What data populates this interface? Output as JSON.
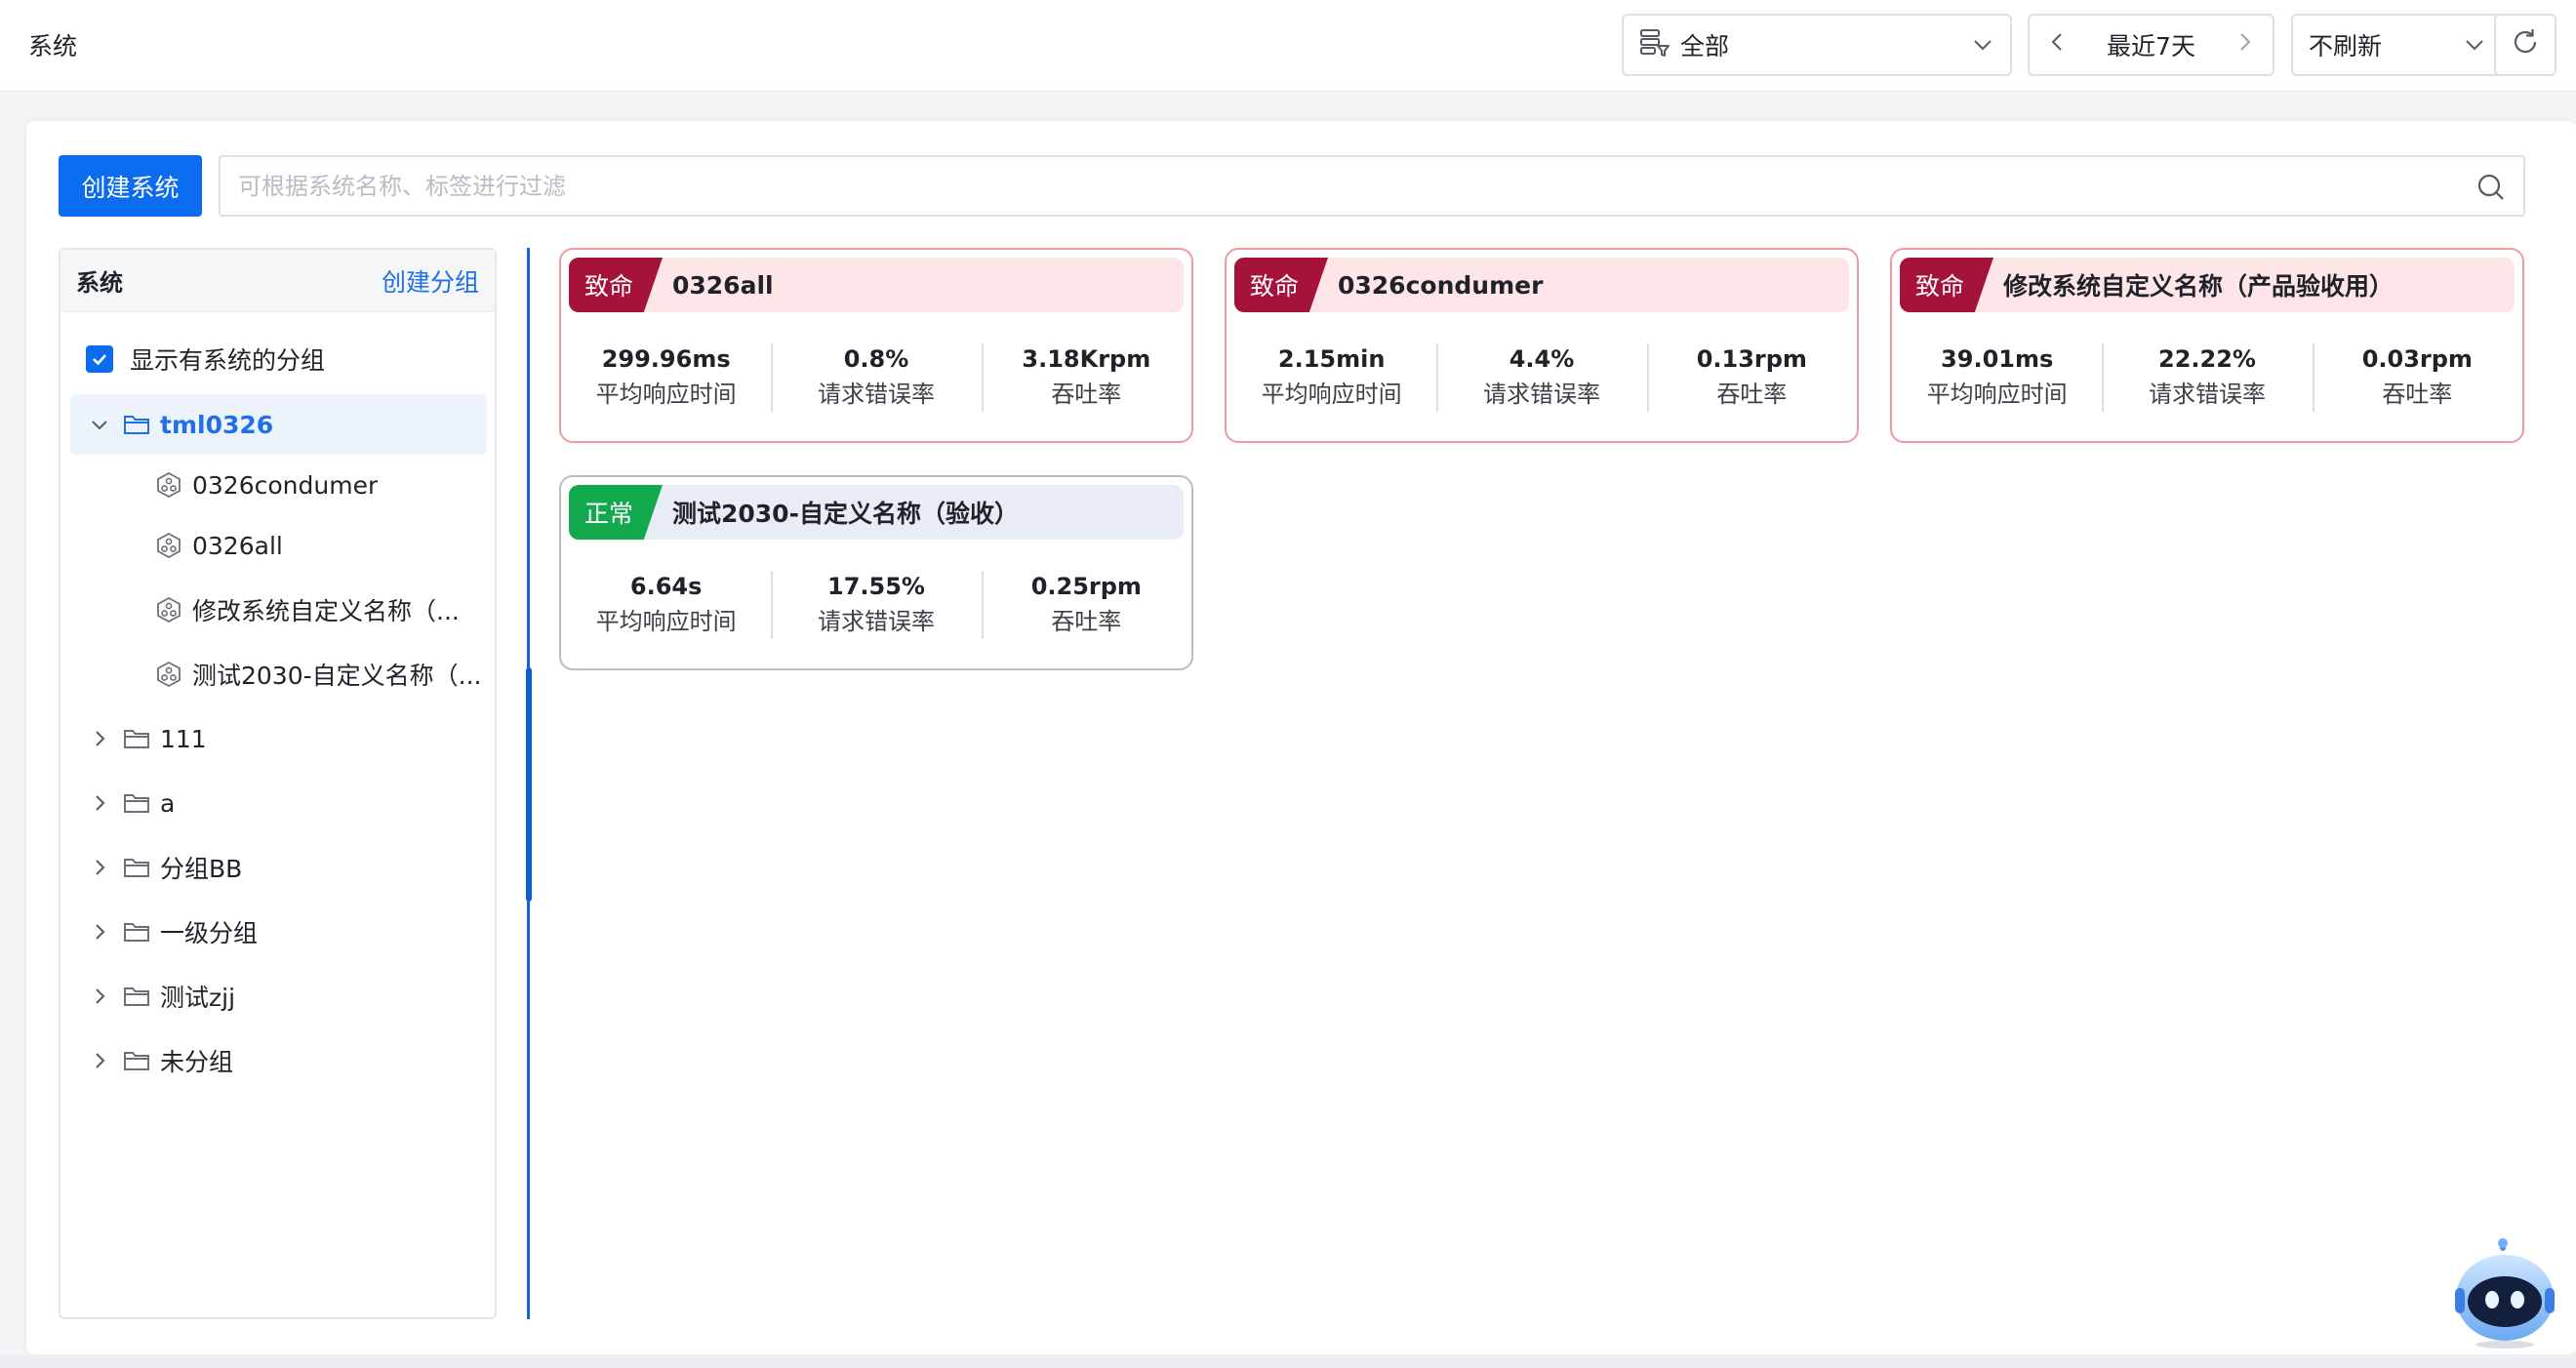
{
  "header": {
    "title": "系统",
    "scope": {
      "label": "全部"
    },
    "time_range": {
      "label": "最近7天"
    },
    "refresh": {
      "label": "不刷新"
    }
  },
  "toolbar": {
    "create_system_label": "创建系统",
    "search_placeholder": "可根据系统名称、标签进行过滤"
  },
  "sidebar": {
    "title": "系统",
    "create_group_label": "创建分组",
    "show_groups_label": "显示有系统的分组",
    "show_groups_checked": true,
    "groups": [
      {
        "name": "tml0326",
        "expanded": true,
        "children": [
          "0326condumer",
          "0326all",
          "修改系统自定义名称（...",
          "测试2030-自定义名称（..."
        ]
      },
      {
        "name": "111",
        "expanded": false
      },
      {
        "name": "a",
        "expanded": false
      },
      {
        "name": "分组BB",
        "expanded": false
      },
      {
        "name": "一级分组",
        "expanded": false
      },
      {
        "name": "测试zjj",
        "expanded": false
      },
      {
        "name": "未分组",
        "expanded": false
      }
    ]
  },
  "cards": [
    {
      "status": "致命",
      "name": "0326all",
      "metrics": [
        {
          "value": "299.96ms",
          "label": "平均响应时间"
        },
        {
          "value": "0.8%",
          "label": "请求错误率"
        },
        {
          "value": "3.18Krpm",
          "label": "吞吐率"
        }
      ]
    },
    {
      "status": "致命",
      "name": "0326condumer",
      "metrics": [
        {
          "value": "2.15min",
          "label": "平均响应时间"
        },
        {
          "value": "4.4%",
          "label": "请求错误率"
        },
        {
          "value": "0.13rpm",
          "label": "吞吐率"
        }
      ]
    },
    {
      "status": "致命",
      "name": "修改系统自定义名称（产品验收用）",
      "metrics": [
        {
          "value": "39.01ms",
          "label": "平均响应时间"
        },
        {
          "value": "22.22%",
          "label": "请求错误率"
        },
        {
          "value": "0.03rpm",
          "label": "吞吐率"
        }
      ]
    },
    {
      "status": "正常",
      "name": "测试2030-自定义名称（验收）",
      "metrics": [
        {
          "value": "6.64s",
          "label": "平均响应时间"
        },
        {
          "value": "17.55%",
          "label": "请求错误率"
        },
        {
          "value": "0.25rpm",
          "label": "吞吐率"
        }
      ]
    }
  ],
  "colors": {
    "primary": "#0b6cf0",
    "fatal": "#a5123a",
    "normal": "#12a84e",
    "fatal_bg": "#fde5e8",
    "normal_bg": "#e8edf5"
  },
  "icons": {
    "scope": "database-filter-icon",
    "prev": "chevron-left-icon",
    "next": "chevron-right-icon",
    "dropdown": "chevron-down-icon",
    "reload": "refresh-icon",
    "search": "search-icon",
    "folder": "folder-icon",
    "system": "system-node-icon",
    "assistant": "robot-assistant-icon"
  }
}
